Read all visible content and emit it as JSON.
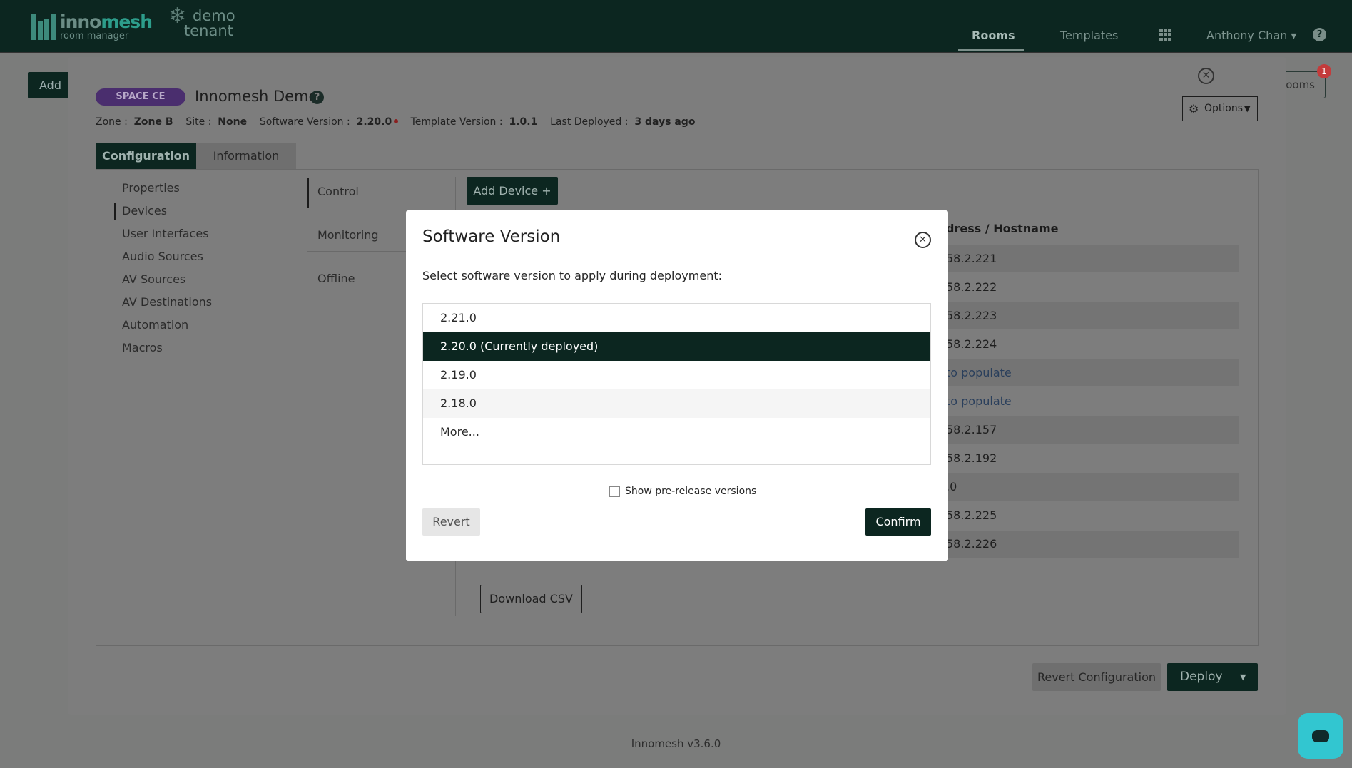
{
  "header": {
    "logo_main_a": "inno",
    "logo_main_b": "mesh",
    "logo_sub": "room manager",
    "tenant_line1": "demo",
    "tenant_line2": "tenant",
    "nav": [
      "Rooms",
      "Templates"
    ],
    "user": "Anthony Chan ▾",
    "help_glyph": "?"
  },
  "background": {
    "add_button": "Add N",
    "rooms_button": "ooms",
    "notification_count": "1"
  },
  "room": {
    "badge": "SPACE CE",
    "title": "Innomesh Demo",
    "zone_label": "Zone :",
    "zone": "Zone B",
    "site_label": "Site :",
    "site": "None",
    "software_label": "Software Version :",
    "software": "2.20.0",
    "template_label": "Template Version :",
    "template": "1.0.1",
    "deployed_label": "Last Deployed :",
    "deployed": "3 days ago",
    "options": "Options"
  },
  "tabs": [
    "Configuration",
    "Information"
  ],
  "sidebar": [
    "Properties",
    "Devices",
    "User Interfaces",
    "Audio Sources",
    "AV Sources",
    "AV Destinations",
    "Automation",
    "Macros"
  ],
  "subnav": [
    "Control",
    "Monitoring",
    "Offline"
  ],
  "devices": {
    "add_button": "Add Device +",
    "host_header": "dress / Hostname",
    "rows": [
      "58.2.221",
      "58.2.222",
      "58.2.223",
      "58.2.224",
      "to populate",
      "to populate",
      "58.2.157",
      "58.2.192",
      ".0",
      "58.2.225",
      "58.2.226"
    ],
    "download": "Download CSV"
  },
  "footer_actions": {
    "revert": "Revert Configuration",
    "deploy": "Deploy"
  },
  "dialog": {
    "title": "Software Version",
    "subtitle": "Select software version to apply during deployment:",
    "versions": [
      "2.21.0",
      "2.20.0 (Currently deployed)",
      "2.19.0",
      "2.18.0",
      "More..."
    ],
    "selected_index": 1,
    "prerelease_label": "Show pre-release versions",
    "prerelease_checked": false,
    "revert": "Revert",
    "confirm": "Confirm"
  },
  "footer": "Innomesh v3.6.0",
  "colors": {
    "brand_dark": "#0c2620",
    "badge_purple": "#4a2e6e",
    "accent_teal": "#32c6d0",
    "notification_red": "#c43b3b"
  }
}
